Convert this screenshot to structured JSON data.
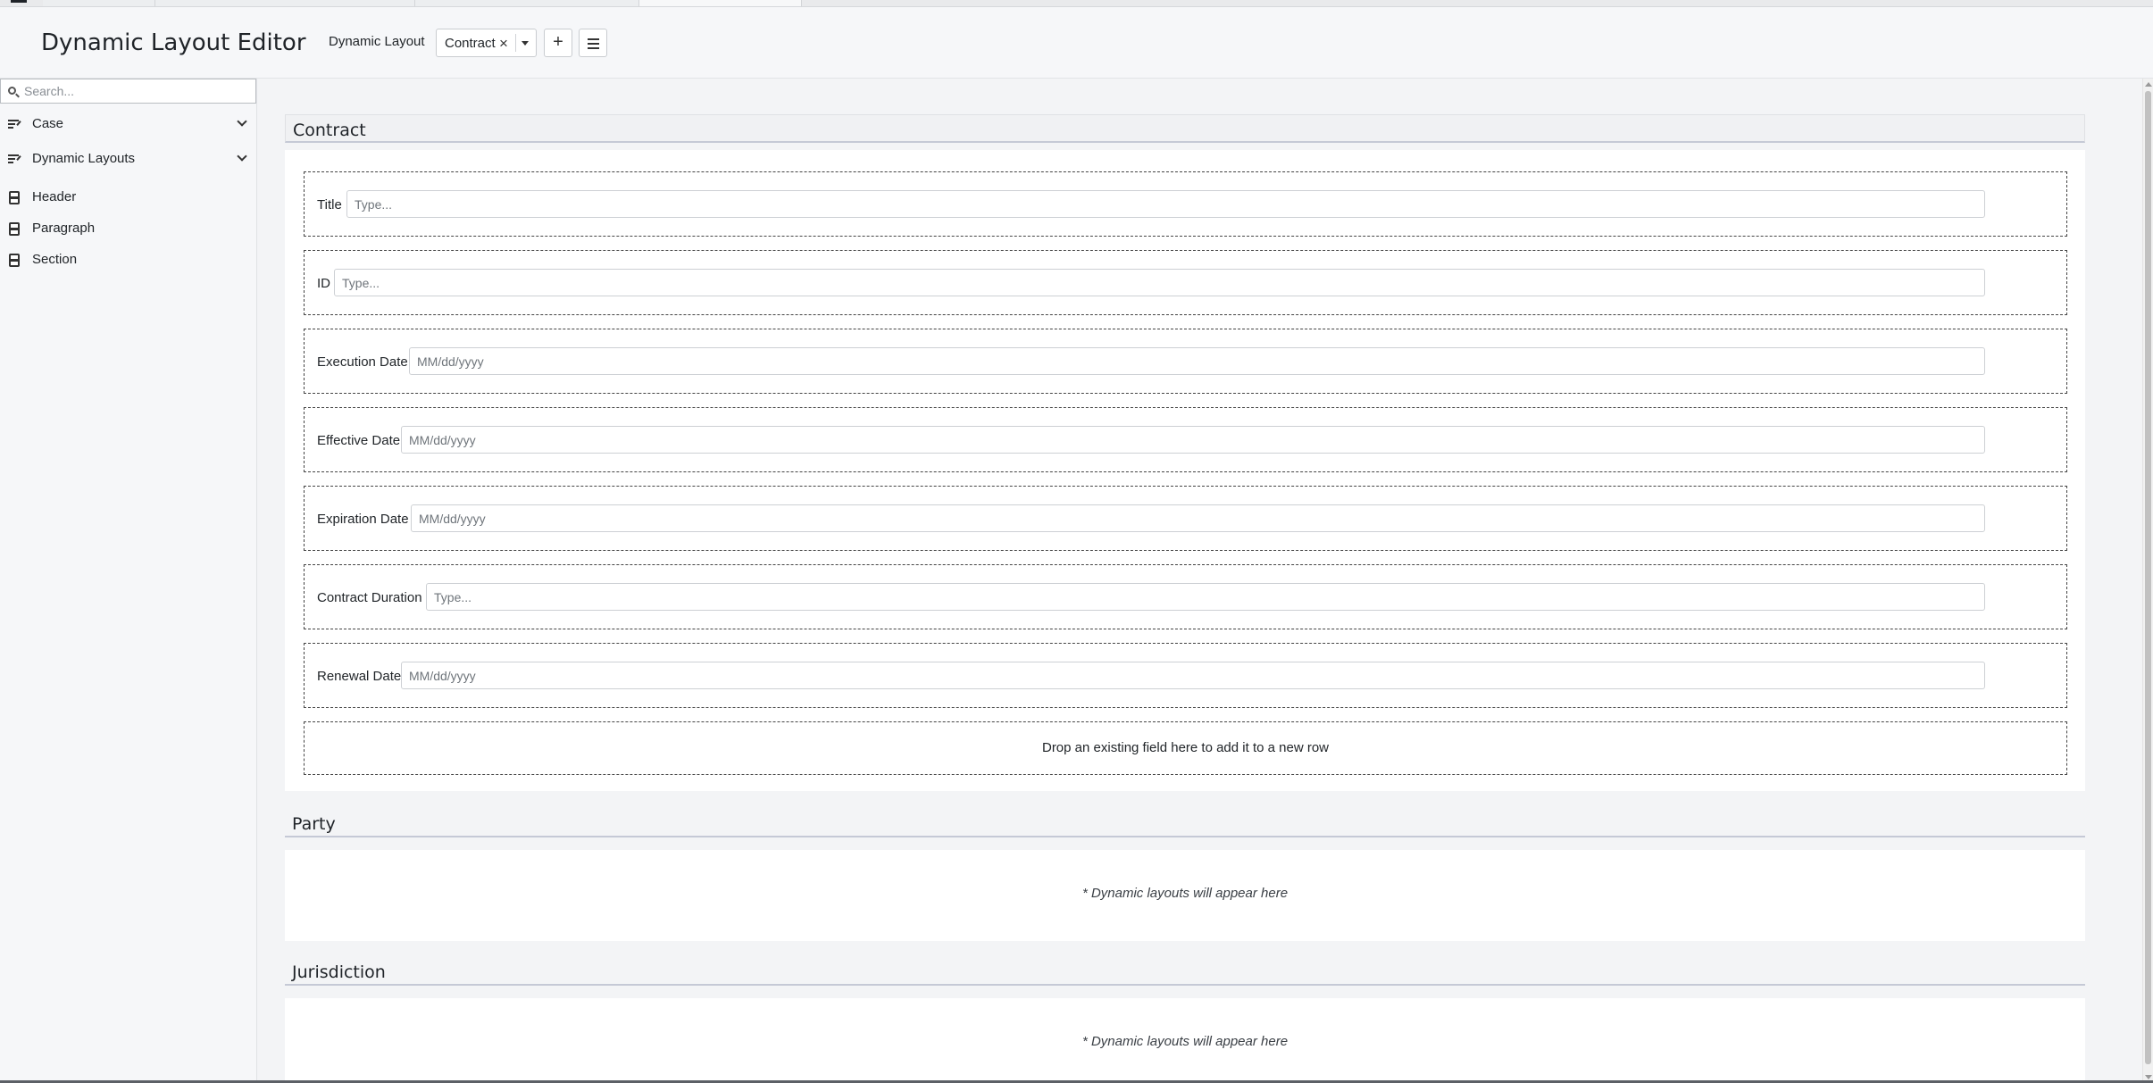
{
  "header": {
    "title": "Dynamic Layout Editor",
    "layout_label": "Dynamic Layout",
    "selected_layout": "Contract",
    "clear_glyph": "×",
    "add_glyph": "+"
  },
  "sidebar": {
    "search_placeholder": "Search...",
    "groups": [
      {
        "label": "Case",
        "icon": "list-edit-icon"
      },
      {
        "label": "Dynamic Layouts",
        "icon": "list-edit-icon"
      }
    ],
    "items": [
      {
        "label": "Header",
        "icon": "block-icon"
      },
      {
        "label": "Paragraph",
        "icon": "block-icon"
      },
      {
        "label": "Section",
        "icon": "block-icon"
      }
    ]
  },
  "main": {
    "sections": [
      {
        "title": "Contract",
        "fields": [
          {
            "label": "Title",
            "placeholder": "Type..."
          },
          {
            "label": "ID",
            "placeholder": "Type..."
          },
          {
            "label": "Execution Date",
            "placeholder": "MM/dd/yyyy"
          },
          {
            "label": "Effective Date",
            "placeholder": "MM/dd/yyyy"
          },
          {
            "label": "Expiration Date",
            "placeholder": "MM/dd/yyyy"
          },
          {
            "label": "Contract Duration",
            "placeholder": "Type..."
          },
          {
            "label": "Renewal Date",
            "placeholder": "MM/dd/yyyy"
          }
        ],
        "drop_hint": "Drop an existing field here to add it to a new row"
      },
      {
        "title": "Party",
        "empty_message": "* Dynamic layouts will appear here"
      },
      {
        "title": "Jurisdiction",
        "empty_message": "* Dynamic layouts will appear here"
      }
    ]
  }
}
